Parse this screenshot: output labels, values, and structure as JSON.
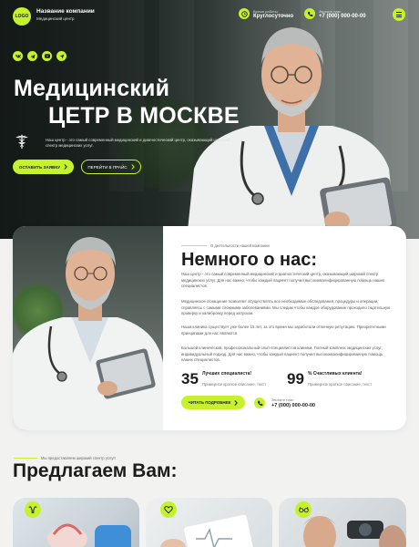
{
  "header": {
    "logo": "LOGO",
    "company_name": "Название компании",
    "company_sub": "Медицинский центр",
    "hours_label": "Время работы:",
    "hours_value": "Круглосуточно",
    "phone_label": "Звоните нам:",
    "phone_value": "+7 (000) 000-00-00"
  },
  "social_icons": [
    "vk-icon",
    "telegram-icon",
    "youtube-icon",
    "send-icon"
  ],
  "hero": {
    "title_line1": "Медицинский",
    "title_line2": "ЦЕТР В МОСКВЕ",
    "description": "Наш центр - это самый современный медицинский и диагностический центр, оказывающий широкий спектр медицинских услуг.",
    "primary_button": "ОСТАВИТЬ ЗАЯВКУ",
    "secondary_button": "ПЕРЕЙТИ В ПРАЙС"
  },
  "about": {
    "overline": "О деятельности нашей компании",
    "title": "Немного о нас:",
    "paragraphs": [
      "Наш центр - это самый современный медицинский и диагностический центр, оказывающий широкий спектр медицинских услуг. Для нас важно, чтобы каждый пациент получил высококвалифицированную помощь наших специалистов.",
      "Медицинское оснащение позволяет осуществлять все необходимые обследования, процедуры и операции, справляясь с самыми сложными заболеваниями. Мы следим чтобы каждое оборудование проходило тщательную проверку и калибровку перед запуском.",
      "Наша клиника существует уже более 15 лет, за это время мы заработали отличную репутацию. Приоритетными принципами для нас являются.",
      "Большой клинический, профессиональный опыт специалистов клиники. Полный комплекс медицинских услуг, индивидуальный подход. Для нас важно, чтобы каждый пациент получил высококвалифицированную помощь наших специалистов."
    ],
    "stats": [
      {
        "number": "35",
        "label": "Лучших специалиста!",
        "desc": "Примерное краткое описание, текст"
      },
      {
        "number": "99",
        "label": "% Счастливых клиента!",
        "desc": "Примерное краткое описание, текст"
      }
    ],
    "more_button": "ЧИТАТЬ ПОДРОБНЕЕ",
    "call_label": "Звоните нам:",
    "call_value": "+7 (000) 000-00-00"
  },
  "services": {
    "overline": "Мы предоставляем широкий спектр услуг!",
    "title": "Предлагаем Вам:",
    "cards": [
      {
        "icon": "uterus-icon"
      },
      {
        "icon": "heart-icon"
      },
      {
        "icon": "glasses-icon"
      }
    ]
  },
  "colors": {
    "accent": "#c6f22b",
    "dark": "#1c1c1c",
    "background": "#f2f3f1"
  }
}
